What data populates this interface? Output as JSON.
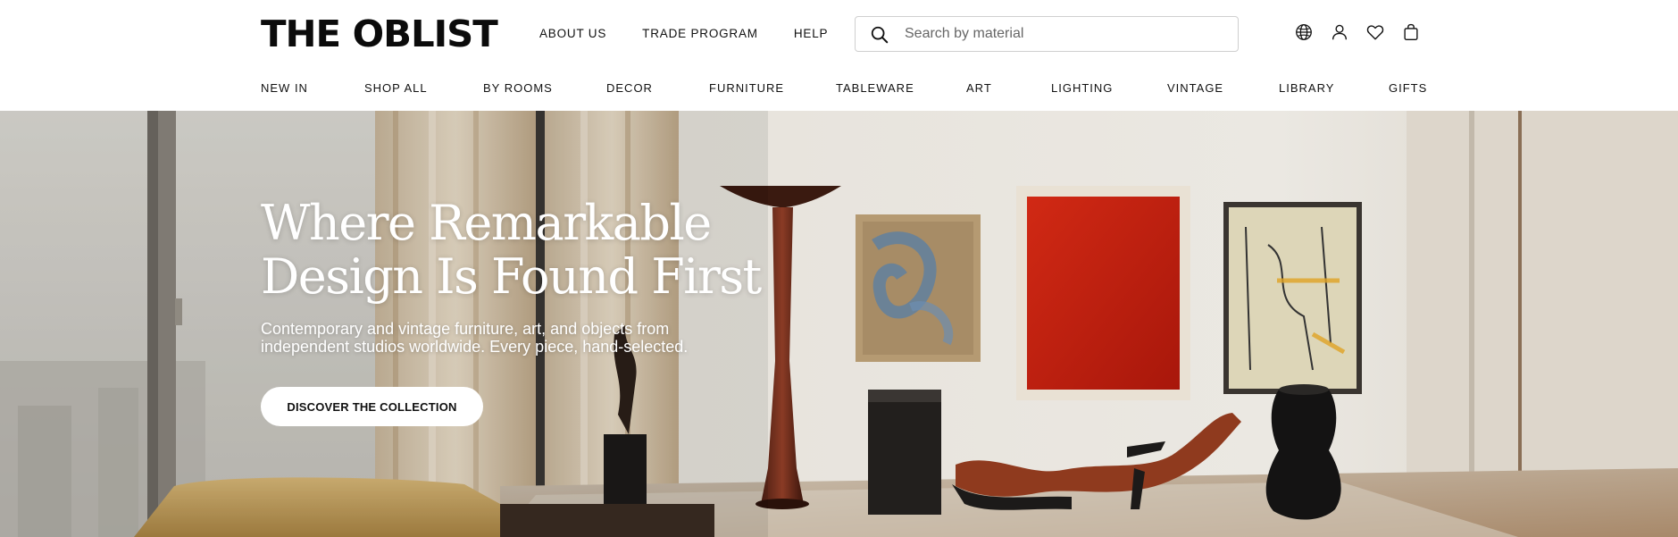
{
  "header": {
    "logo": "THE OBLIST",
    "top_nav": [
      "ABOUT US",
      "TRADE PROGRAM",
      "HELP"
    ],
    "search": {
      "placeholder": "Search by material",
      "value": ""
    },
    "utility_icons": [
      "globe-icon",
      "user-icon",
      "heart-icon",
      "bag-icon"
    ]
  },
  "category_nav": [
    "NEW IN",
    "SHOP ALL",
    "BY ROOMS",
    "DECOR",
    "FURNITURE",
    "TABLEWARE",
    "ART",
    "LIGHTING",
    "VINTAGE",
    "LIBRARY",
    "GIFTS"
  ],
  "hero": {
    "headline_line1": "Where Remarkable",
    "headline_line2": "Design Is Found First",
    "subhead_line1": "Contemporary and vintage furniture, art, and objects from",
    "subhead_line2": "independent studios worldwide. Every piece, hand-selected.",
    "cta_label": "DISCOVER THE COLLECTION"
  },
  "colors": {
    "brand_text": "#0b0b0b",
    "hero_text": "#ffffff",
    "cta_background": "#ffffff",
    "painting_red": "#c11e10"
  }
}
